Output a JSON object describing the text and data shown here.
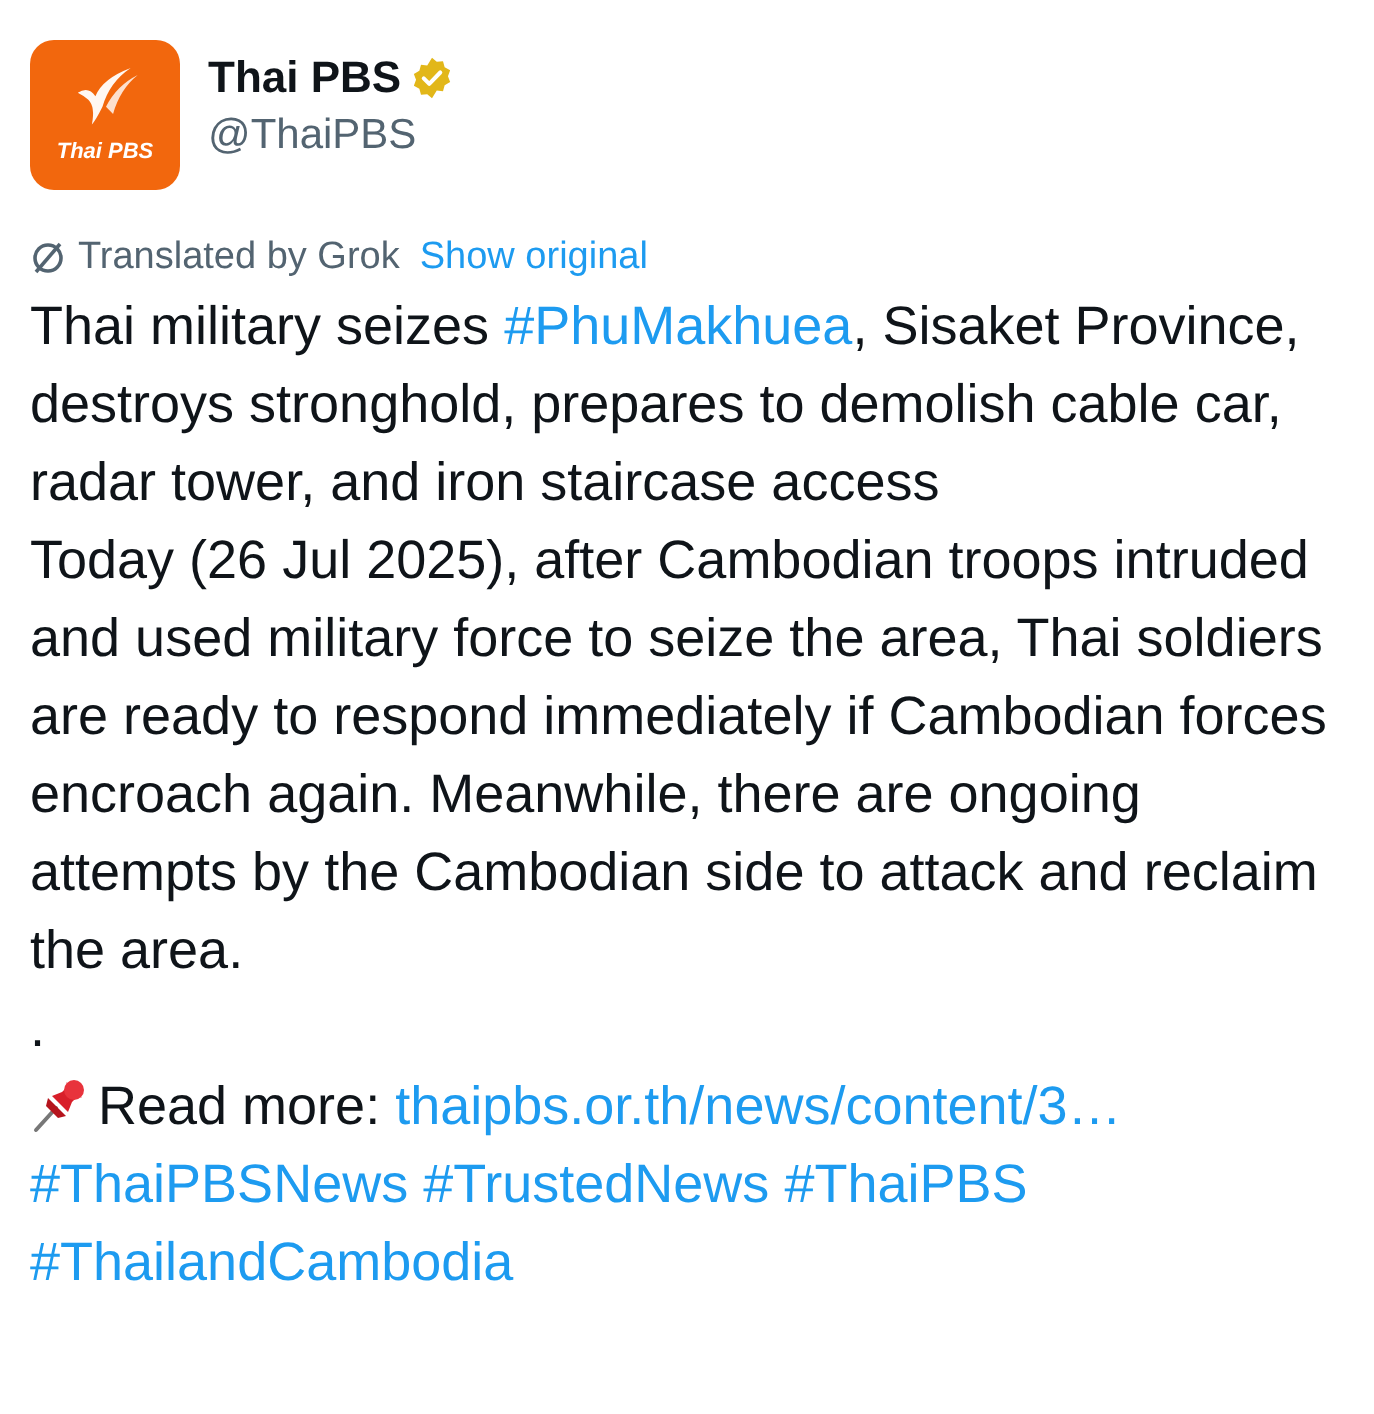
{
  "account": {
    "logo_text": "Thai PBS",
    "name": "Thai PBS",
    "verified": true,
    "handle": "@ThaiPBS"
  },
  "translation": {
    "note": "Translated by Grok",
    "action": "Show original"
  },
  "paragraphs": [
    {
      "parts": [
        {
          "kind": "text",
          "text": "Thai military seizes "
        },
        {
          "kind": "link",
          "text": "#PhuMakhuea"
        },
        {
          "kind": "text",
          "text": ", Sisaket Province, destroys stronghold, prepares to demolish cable car, radar tower, and iron staircase access"
        }
      ]
    },
    {
      "parts": [
        {
          "kind": "text",
          "text": "Today (26 Jul 2025), after Cambodian troops intruded and used military force to seize the area, Thai soldiers are ready to respond immediately if Cambodian forces encroach again. Meanwhile, there are ongoing attempts by the Cambodian side to attack and reclaim the area."
        }
      ]
    },
    {
      "parts": [
        {
          "kind": "text",
          "text": "."
        }
      ]
    },
    {
      "parts": [
        {
          "kind": "pin"
        },
        {
          "kind": "text",
          "text": "Read more: "
        },
        {
          "kind": "link",
          "text": "thaipbs.or.th/news/content/3…"
        }
      ]
    },
    {
      "parts": [
        {
          "kind": "link",
          "text": "#ThaiPBSNews"
        },
        {
          "kind": "link",
          "text": "#TrustedNews"
        },
        {
          "kind": "link",
          "text": "#ThaiPBS"
        },
        {
          "kind": "link",
          "text": "#ThailandCambodia"
        }
      ]
    }
  ]
}
